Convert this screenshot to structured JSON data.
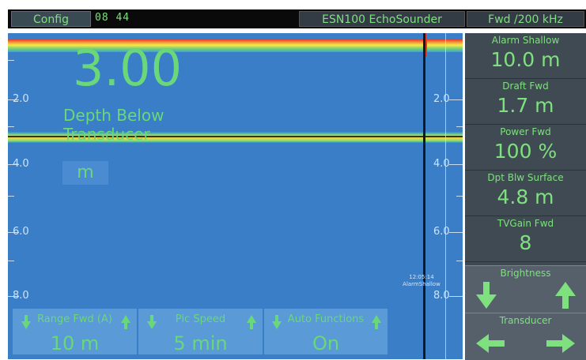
{
  "topbar": {
    "config_label": "Config",
    "clock": "08 44",
    "device": "ESN100 EchoSounder",
    "frequency": "Fwd /200 kHz"
  },
  "echogram": {
    "depth": "3.00",
    "depth_name": "Depth Below Transducer",
    "unit": "m",
    "scale_left": [
      "2.0",
      "4.0",
      "6.0",
      "8.0"
    ],
    "scale_right": [
      "2.0",
      "4.0",
      "6.0",
      "8.0"
    ],
    "alarm_time": "12:05:14",
    "alarm_name": "AlarmShallow"
  },
  "controls": [
    {
      "title": "Range Fwd (A)",
      "value": "10 m"
    },
    {
      "title": "Pic Speed",
      "value": "5 min"
    },
    {
      "title": "Auto Functions",
      "value": "On"
    }
  ],
  "side_panel": {
    "items": [
      {
        "title": "Alarm Shallow",
        "value": "10.0 m"
      },
      {
        "title": "Draft Fwd",
        "value": "1.7 m"
      },
      {
        "title": "Power Fwd",
        "value": "100 %"
      },
      {
        "title": "Dpt Blw Surface",
        "value": "4.8 m"
      },
      {
        "title": "TVGain Fwd",
        "value": "8"
      }
    ],
    "brightness_label": "Brightness",
    "transducer_label": "Transducer"
  },
  "colors": {
    "accent_green": "#69d77a",
    "echogram_blue": "#3a7ec8",
    "panel_gray": "#3f4a52"
  },
  "icons": [
    "arrow-down-icon",
    "arrow-up-icon",
    "arrow-left-icon",
    "arrow-right-icon"
  ]
}
